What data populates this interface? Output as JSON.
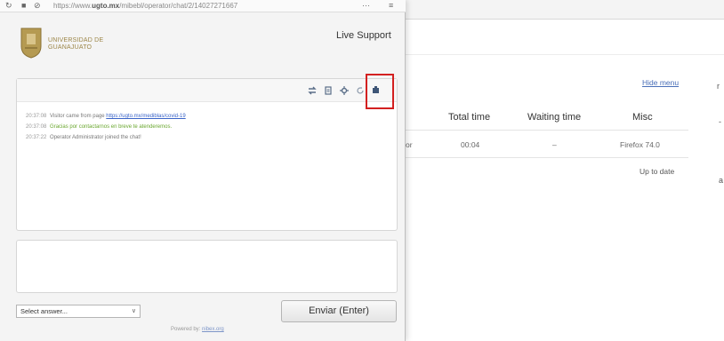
{
  "background": {
    "hide_menu": "Hide menu",
    "table": {
      "headers": [
        "r",
        "Total time",
        "Waiting time",
        "Misc"
      ],
      "row": [
        "or",
        "00:04",
        "–",
        "Firefox 74.0"
      ]
    },
    "up_to_date": "Up to date",
    "top_icons": "⊡ ··· ⊚ ☆",
    "side_marks": [
      "r",
      "-",
      "a"
    ]
  },
  "popup": {
    "url_prefix": "https://www.",
    "url_domain": "ugto.mx",
    "url_path": "/mibebl/operator/chat/2/14027271667",
    "url_dots": "···",
    "org_name_line1": "UNIVERSIDAD DE",
    "org_name_line2": "GUANAJUATO",
    "header_title": "Live Support",
    "messages": [
      {
        "time": "20:37:08",
        "text": "Visitor came from page",
        "link": "https://ugto.mx/mediblas/covid-19"
      },
      {
        "time": "20:37:08",
        "text": "Gracias por contactarnos en breve te atenderemos."
      },
      {
        "time": "20:37:22",
        "text": "Operator Administrator joined the chat!"
      }
    ],
    "select_answer": "Select answer...",
    "send_label": "Enviar (Enter)",
    "powered_prefix": "Powered by:",
    "powered_link": "nibex.org"
  },
  "colors": {
    "highlight": "#d32020",
    "link": "#3a64c8",
    "greeting": "#6aa72f",
    "logo_gold": "#9c8648"
  }
}
